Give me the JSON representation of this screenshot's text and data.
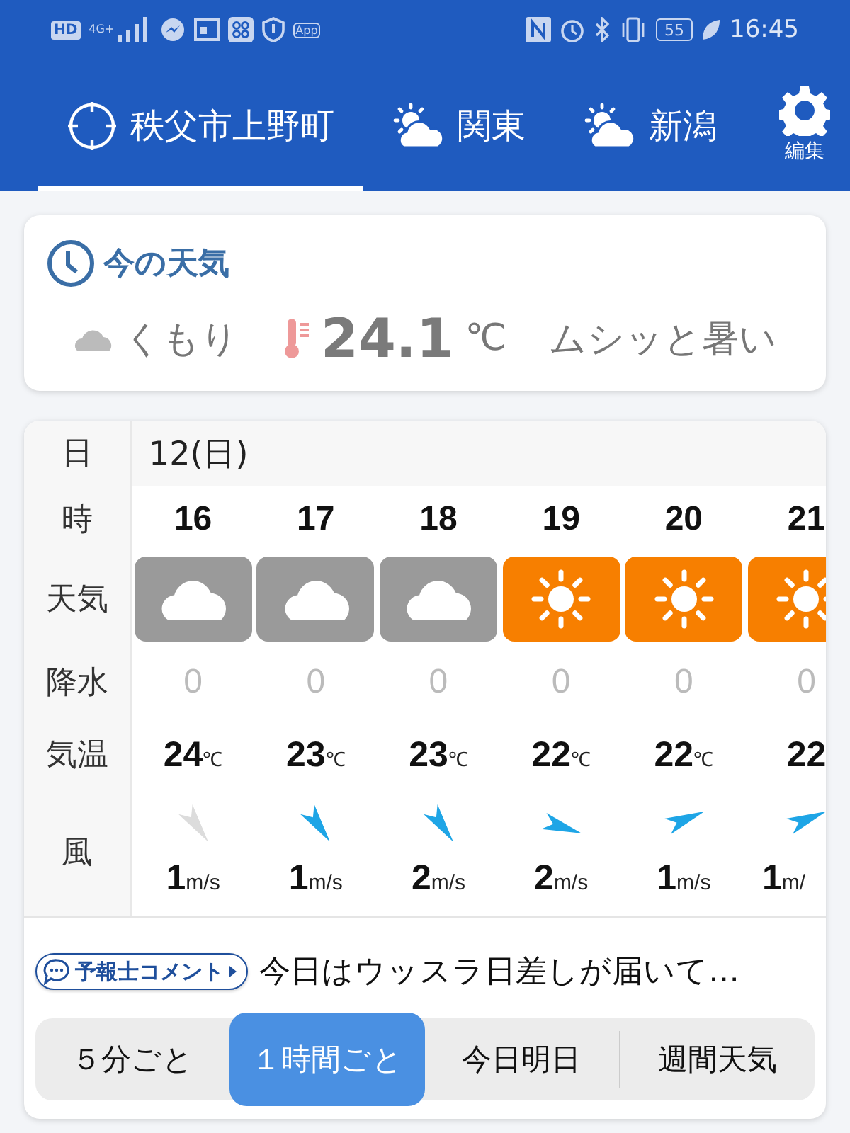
{
  "status_bar": {
    "hd": "HD",
    "network": "4G+",
    "app_badge": "App",
    "battery": "55",
    "time": "16:45"
  },
  "tabs": [
    {
      "kind": "location",
      "label": "秩父市上野町",
      "selected": true
    },
    {
      "kind": "weather",
      "label": "関東",
      "selected": false
    },
    {
      "kind": "weather",
      "label": "新潟",
      "selected": false
    }
  ],
  "settings": {
    "label": "編集"
  },
  "now": {
    "title": "今の天気",
    "condition": "くもり",
    "temperature": "24.1",
    "unit": "℃",
    "feel": "ムシッと暑い"
  },
  "hourly": {
    "labels": {
      "date": "日",
      "hour": "時",
      "weather": "天気",
      "precip": "降水",
      "temp": "気温",
      "wind": "風"
    },
    "date": "12(日)",
    "columns": [
      {
        "hour": "16",
        "kind": "cloudy",
        "precip": "0",
        "temp": "24",
        "temp_unit": "℃",
        "arrow": {
          "kind": "SE",
          "light": true
        },
        "wind": "1",
        "wind_unit": "m/s"
      },
      {
        "hour": "17",
        "kind": "cloudy",
        "precip": "0",
        "temp": "23",
        "temp_unit": "℃",
        "arrow": {
          "kind": "SE",
          "light": false
        },
        "wind": "1",
        "wind_unit": "m/s"
      },
      {
        "hour": "18",
        "kind": "cloudy",
        "precip": "0",
        "temp": "23",
        "temp_unit": "℃",
        "arrow": {
          "kind": "SE",
          "light": false
        },
        "wind": "2",
        "wind_unit": "m/s"
      },
      {
        "hour": "19",
        "kind": "sunny",
        "precip": "0",
        "temp": "22",
        "temp_unit": "℃",
        "arrow": {
          "kind": "ESE",
          "light": false
        },
        "wind": "2",
        "wind_unit": "m/s"
      },
      {
        "hour": "20",
        "kind": "sunny",
        "precip": "0",
        "temp": "22",
        "temp_unit": "℃",
        "arrow": {
          "kind": "ENE",
          "light": false
        },
        "wind": "1",
        "wind_unit": "m/s"
      },
      {
        "hour": "21",
        "kind": "sunny",
        "precip": "0",
        "temp": "22",
        "arrow": {
          "kind": "ENE",
          "light": false
        },
        "wind": "1",
        "wind_unit": "m/"
      }
    ]
  },
  "comment": {
    "badge": "予報士コメント",
    "text": "今日はウッスラ日差しが届いて…"
  },
  "segments": [
    {
      "label": "５分ごと",
      "selected": false
    },
    {
      "label": "１時間ごと",
      "selected": true
    },
    {
      "label": "今日明日",
      "selected": false
    },
    {
      "label": "週間天気",
      "selected": false
    }
  ]
}
